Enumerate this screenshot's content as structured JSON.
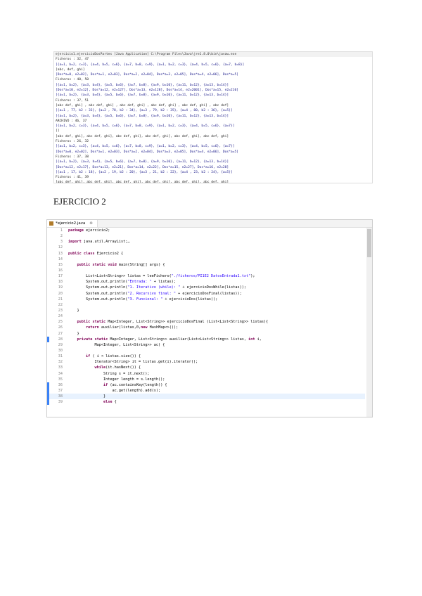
{
  "console": {
    "lines": [
      "ejercicio1.ejercicioDosPartes [Java Application] C:\\Program Files\\Java\\jre1.8.0\\bin\\javaw.exe",
      "Ficheros : 32, 47",
      "[{a=1, b=2, c=3}, {a=4, b=5, c=6}, {a=7, b=8, c=9}, {a=1, b=2, c=3}, {a=4, b=5, c=6}, {a=7, b=8}]",
      "[abc, def, ghi]",
      "[Dos*a=0, e2=02], Dos*a=1, e2=03], Dos*a=2, e2=04], Dos*a=3, e2=05], Dos*a=4, e2=06], Dos*a=5]",
      "Ficheros : 40, 50",
      "[{a=1, b=2}, {a=3, b=4}, {a=5, b=6}, {a=7, b=8}, {a=9, b=10}, {a=11, b=12}, {a=13, b=14}]",
      "[Dos*a=10, e2=12], Dos*a=12, e2=127], Dos*a=13, e2=128], Dos*a=14, e2=2001], Dos*a=15, e2=210]",
      "[{a=1, b=2}, {a=3, b=4}, {a=5, b=6}, {a=7, b=8}, {a=9, b=10}, {a=11, b=12}, {a=13, b=14}]",
      "Ficheros : 37, 51",
      "[abc def, ghi] , abc def, ghi] , abc def, ghi] , abc def, ghi] , abc def, ghi] , abc def]",
      "[{a=1 , 77, b2 : 33}, {a=2 , 78, b2 : 34}, {a=3 , 79, b2 : 35}, {a=4 , 80, b2 : 36}, {a=5}]",
      "[{a=1, b=2}, {a=3, b=4}, {a=5, b=6}, {a=7, b=8}, {a=9, b=10}, {a=11, b=12}, {a=13, b=14}]",
      "ARCHIVO : 46, 37",
      "[{a=1, b=2, c=3}, {a=4, b=5, c=6}, {a=7, b=8, c=9}, {a=1, b=2, c=3}, {a=4, b=5, c=6}, {a=7}]",
      "[]",
      "[abc def, ghi], abc def, ghi], abc def, ghi], abc def, ghi], abc def, ghi], abc def, ghi]",
      "Ficheros : 26, 32",
      "[{a=1, b=2, c=3}, {a=4, b=5, c=6}, {a=7, b=8, c=9}, {a=1, b=2, c=3}, {a=4, b=5, c=6}, {a=7}]",
      "[Dos*a=0, e2=02], Dos*a=1, e2=03], Dos*a=2, e2=04], Dos*a=3, e2=05], Dos*a=4, e2=06], Dos*a=5]",
      "Ficheros : 37, 38",
      "[{a=1, b=2}, {a=3, b=4}, {a=5, b=6}, {a=7, b=8}, {a=9, b=10}, {a=11, b=12}, {a=13, b=14}]",
      "[Dos*a=12, e2=17], Dos*a=13, e2=21], Dos*a=14, e2=22], Dos*a=15, e2=27], Dos*a=16, e2=28]",
      "[{a=1 , 17, b2 : 18}, {a=2 , 19, b2 : 20}, {a=3 , 21, b2 : 22}, {a=4 , 23, b2 : 24}, {a=5}]",
      "Ficheros : 41, 39",
      "[abc def, ghi], abc def, ghi], abc def, ghi], abc def, ghi], abc def, ghi], abc def, ghi]"
    ]
  },
  "heading": "EJERCICIO 2",
  "editor": {
    "tab_label": "*ejercicio2.java",
    "tab_close": "⊗",
    "lines": [
      {
        "n": "1",
        "code": "package ejercicio2;"
      },
      {
        "n": "2",
        "code": ""
      },
      {
        "n": "3",
        "code": "import java.util.ArrayList;…"
      },
      {
        "n": "12",
        "code": ""
      },
      {
        "n": "13",
        "code": "public class Ejercicio2 {"
      },
      {
        "n": "14",
        "code": ""
      },
      {
        "n": "15",
        "code": "    public static void main(String[] args) {"
      },
      {
        "n": "16",
        "code": ""
      },
      {
        "n": "17",
        "code": "        List<List<String>> listas = leeFichero(\"./ficheros/PI1E2 DatosEntrada1.txt\");"
      },
      {
        "n": "18",
        "code": "        System.out.println(\"Entrada: \" + listas);"
      },
      {
        "n": "19",
        "code": "        System.out.println(\"1. Iterativo (while): \" + ejercicioDosWhile(listas));"
      },
      {
        "n": "20",
        "code": "        System.out.println(\"2. Recursivo final: \" + ejercicioDosFinal(listas));"
      },
      {
        "n": "21",
        "code": "        System.out.println(\"3. Funcional: \" + ejercicioDos(listas));"
      },
      {
        "n": "22",
        "code": ""
      },
      {
        "n": "23",
        "code": "    }"
      },
      {
        "n": "24",
        "code": ""
      },
      {
        "n": "25",
        "code": "    public static Map<Integer, List<String>> ejercicioDosFinal (List<List<String>> listas){"
      },
      {
        "n": "26",
        "code": "        return auxiliar(listas,0,new HashMap<>());"
      },
      {
        "n": "27",
        "code": "    }"
      },
      {
        "n": "28",
        "code": "    private static Map<Integer, List<String>> auxiliar(List<List<String>> listas, int i,"
      },
      {
        "n": "29",
        "code": "            Map<Integer, List<String>> ac) {"
      },
      {
        "n": "30",
        "code": ""
      },
      {
        "n": "31",
        "code": "        if ( i < listas.size()) {"
      },
      {
        "n": "32",
        "code": "            Iterator<String> it = listas.get(i).iterator();"
      },
      {
        "n": "33",
        "code": "            while(it.hasNext()) {"
      },
      {
        "n": "34",
        "code": "                String s = it.next();"
      },
      {
        "n": "35",
        "code": "                Integer length = s.length();"
      },
      {
        "n": "36",
        "code": "                if (ac.containsKey(length)) {"
      },
      {
        "n": "37",
        "code": "                    ac.get(length).add(s);"
      },
      {
        "n": "38",
        "code": "                }"
      },
      {
        "n": "39",
        "code": "                else {"
      }
    ]
  }
}
